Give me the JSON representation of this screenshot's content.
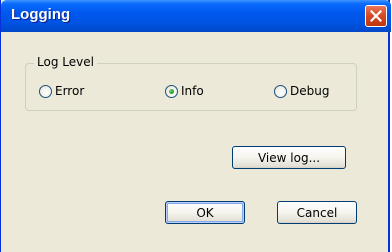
{
  "window": {
    "title": "Logging"
  },
  "log_level": {
    "label": "Log Level",
    "options": [
      {
        "label": "Error",
        "selected": false
      },
      {
        "label": "Info",
        "selected": true
      },
      {
        "label": "Debug",
        "selected": false
      }
    ]
  },
  "buttons": {
    "view_log": "View log...",
    "ok": "OK",
    "cancel": "Cancel"
  },
  "colors": {
    "titlebar": "#0054e3",
    "window_bg": "#ece9d8",
    "close_button": "#d84a22",
    "radio_selected": "#21a121"
  },
  "icons": {
    "close": "close-icon"
  }
}
